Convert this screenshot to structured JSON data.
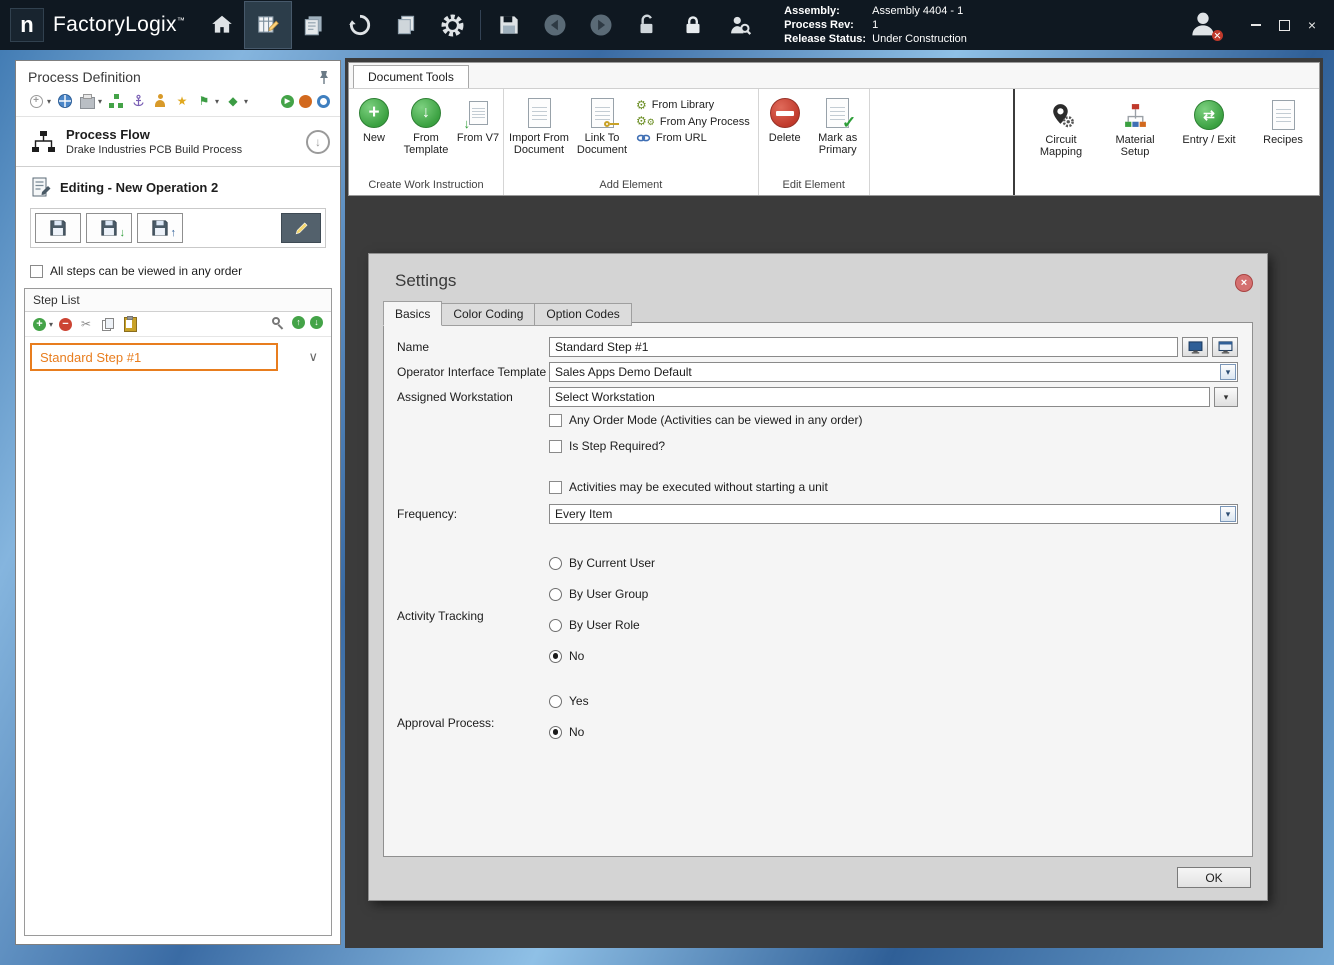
{
  "colors": {
    "accent_orange": "#e87d1e",
    "ribbon_green": "#3aa040",
    "delete_red": "#c0392b",
    "titlebar_bg": "#0f1821"
  },
  "icons": {
    "plus": "+",
    "minus": "−",
    "caret_down": "▾",
    "chevron_down": "∨",
    "arrow_up": "↑",
    "arrow_down": "↓",
    "swap_arrows": "⇄",
    "check": "✓",
    "gear": "⚙",
    "scissors": "✂",
    "star": "★",
    "flag": "⚑",
    "diamond": "◆",
    "play": "▶",
    "close": "×"
  },
  "titlebar": {
    "logo_letter": "n",
    "app_name": "FactoryLogix",
    "trademark": "™",
    "assembly_label": "Assembly:",
    "assembly_value": "Assembly 4404 - 1",
    "process_rev_label": "Process Rev:",
    "process_rev_value": "1",
    "release_status_label": "Release Status:",
    "release_status_value": "Under Construction"
  },
  "left_panel": {
    "title": "Process Definition",
    "process_flow_title": "Process Flow",
    "process_flow_subtitle": "Drake Industries PCB Build Process",
    "editing_label": "Editing - New Operation 2",
    "order_checkbox_label": "All steps can be viewed in any order",
    "step_list_title": "Step List",
    "steps": [
      {
        "label": "Standard Step #1"
      }
    ]
  },
  "ribbon": {
    "tab": "Document Tools",
    "create_group": {
      "label": "Create Work Instruction",
      "new": "New",
      "from_template": "From Template",
      "from_v7": "From V7"
    },
    "add_group": {
      "label": "Add Element",
      "import_from_document": "Import From Document",
      "link_to_document": "Link To Document",
      "from_library": "From Library",
      "from_any_process": "From Any Process",
      "from_url": "From URL"
    },
    "edit_group": {
      "label": "Edit Element",
      "delete": "Delete",
      "mark_as_primary": "Mark as Primary"
    },
    "right_buttons": [
      "Circuit Mapping",
      "Material Setup",
      "Entry / Exit",
      "Recipes"
    ]
  },
  "settings": {
    "title": "Settings",
    "tabs": [
      "Basics",
      "Color Coding",
      "Option Codes"
    ],
    "active_tab": "Basics",
    "name_label": "Name",
    "name_value": "Standard Step #1",
    "template_label": "Operator Interface Template",
    "template_value": "Sales Apps Demo Default",
    "workstation_label": "Assigned Workstation",
    "workstation_value": "Select Workstation",
    "checkbox_any_order": "Any Order Mode (Activities can be viewed in any order)",
    "checkbox_required": "Is Step Required?",
    "checkbox_no_unit": "Activities may be executed without starting a unit",
    "frequency_label": "Frequency:",
    "frequency_value": "Every Item",
    "activity_label": "Activity Tracking",
    "activity_options": [
      "By Current User",
      "By User Group",
      "By User Role",
      "No"
    ],
    "activity_selected": "No",
    "approval_label": "Approval Process:",
    "approval_options": [
      "Yes",
      "No"
    ],
    "approval_selected": "No",
    "ok": "OK"
  }
}
